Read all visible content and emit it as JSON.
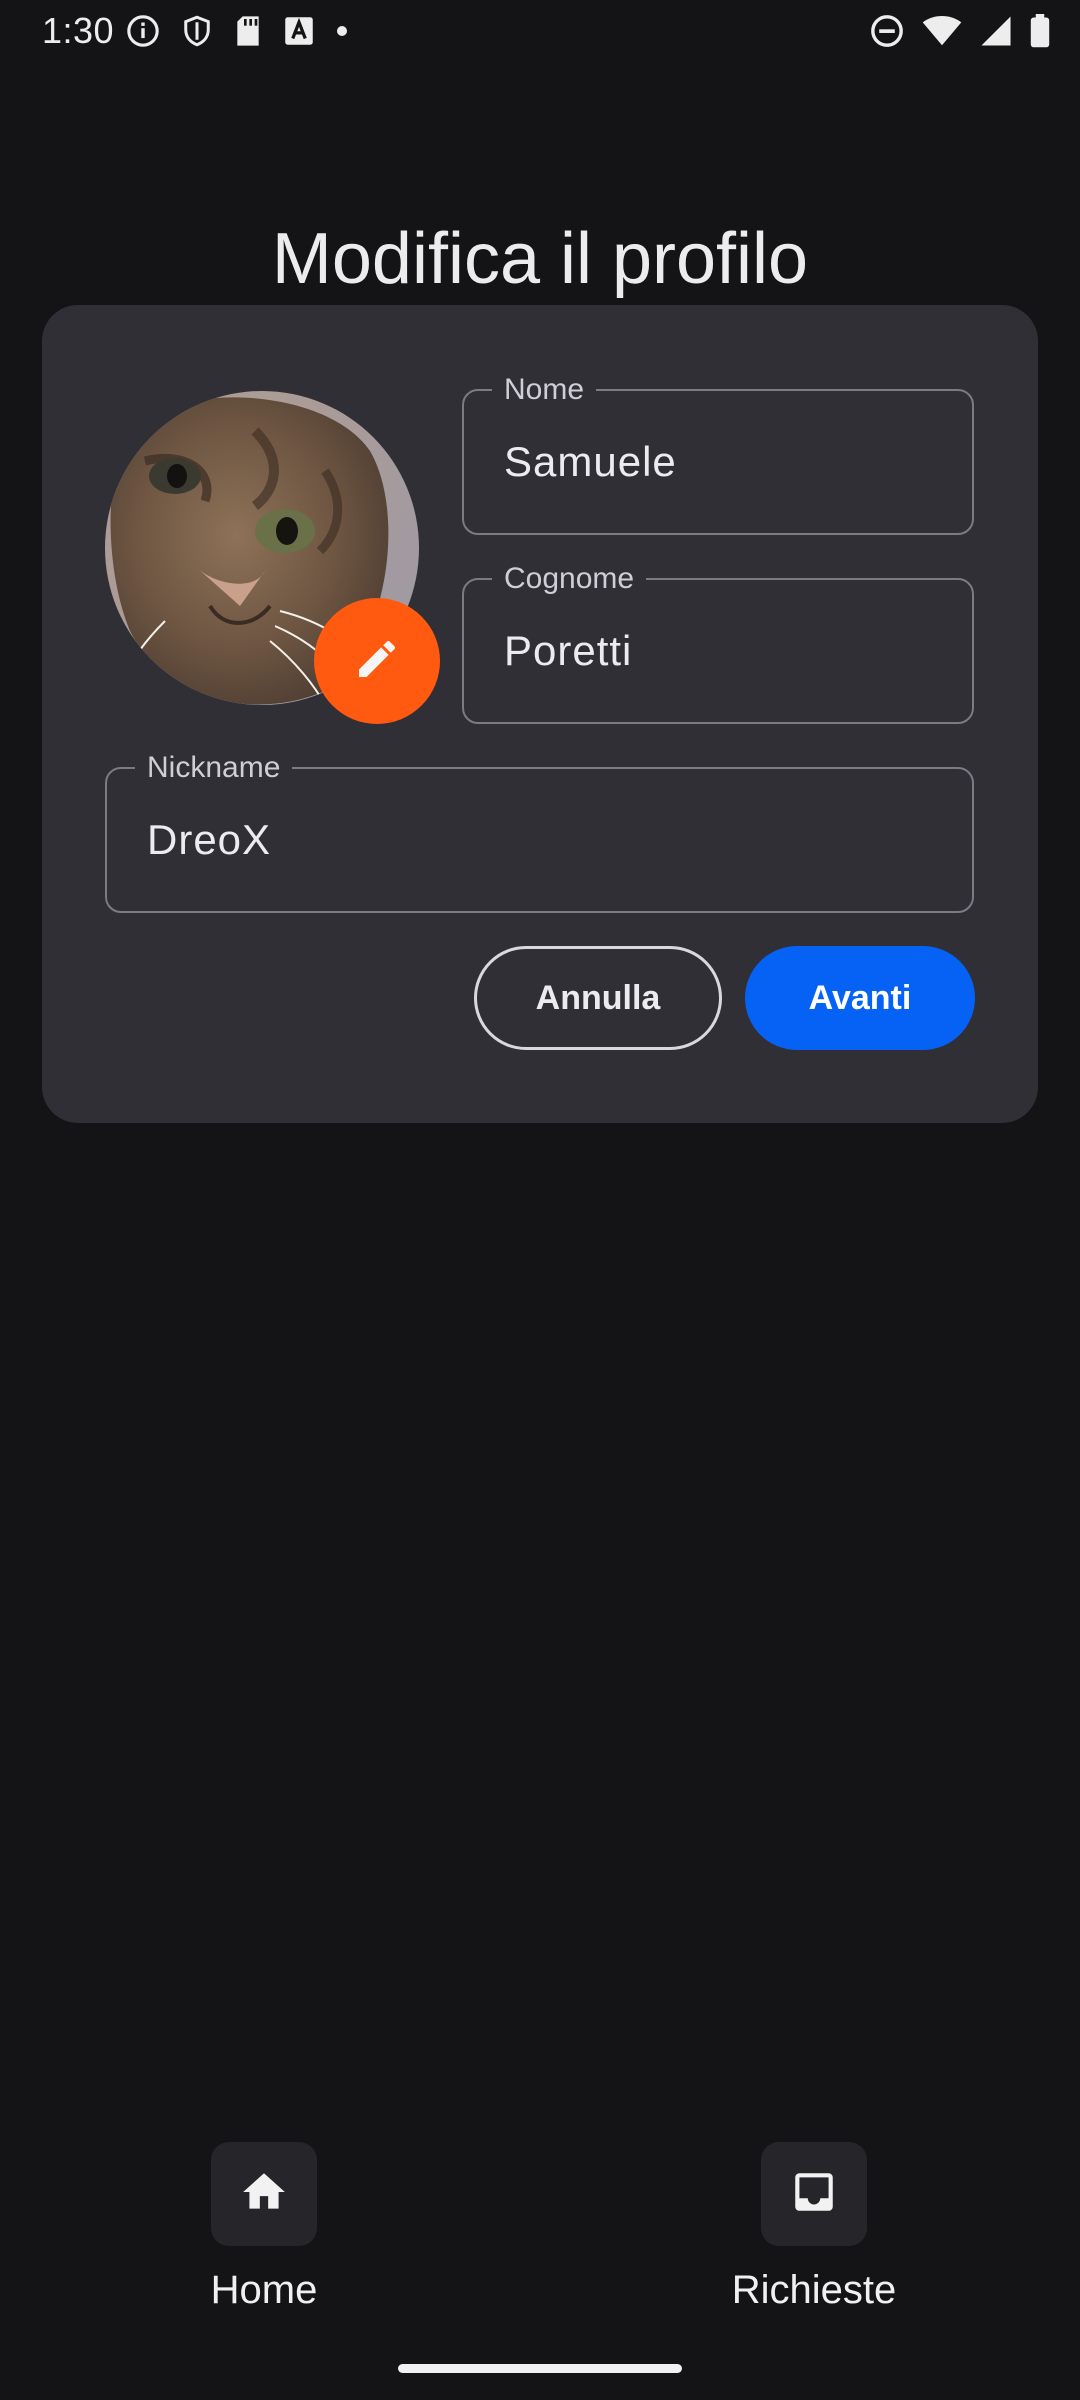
{
  "status_bar": {
    "time": "1:30",
    "left_icons": [
      "info-icon",
      "shield-icon",
      "sd-card-icon",
      "font-a-icon",
      "dot-icon"
    ],
    "right_icons": [
      "do-not-disturb-icon",
      "wifi-icon",
      "cellular-signal-icon",
      "battery-icon"
    ]
  },
  "page": {
    "title": "Modifica il profilo"
  },
  "profile_form": {
    "avatar_icon": "cat-photo",
    "edit_icon": "pencil-icon",
    "first_name": {
      "label": "Nome",
      "value": "Samuele"
    },
    "last_name": {
      "label": "Cognome",
      "value": "Poretti"
    },
    "nickname": {
      "label": "Nickname",
      "value": "DreoX"
    },
    "cancel_label": "Annulla",
    "next_label": "Avanti"
  },
  "bottom_nav": {
    "items": [
      {
        "label": "Home",
        "icon": "home-icon"
      },
      {
        "label": "Richieste",
        "icon": "inbox-icon"
      }
    ]
  },
  "colors": {
    "background": "#141416",
    "card": "#302F36",
    "accent_orange": "#FF5A0F",
    "primary_blue": "#0562F5"
  }
}
